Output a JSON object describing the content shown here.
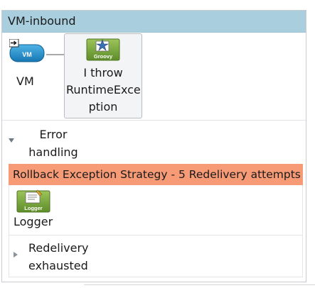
{
  "flow": {
    "title": "VM-inbound",
    "source": {
      "label": "VM",
      "icon": "vm-endpoint-icon",
      "icon_text": "VM"
    },
    "component": {
      "label": "I throw RuntimeException",
      "label_lines": [
        "I throw",
        "RuntimeExce",
        "ption"
      ],
      "icon": "groovy-icon",
      "icon_text": "Groovy"
    },
    "error_handling": {
      "label_lines": [
        "Error",
        "handling"
      ],
      "expanded": true,
      "strategy": {
        "title": "Rollback Exception Strategy - 5 Redelivery attempts",
        "processor": {
          "label": "Logger",
          "icon": "logger-icon",
          "icon_text": "Logger"
        },
        "redelivery": {
          "label_lines": [
            "Redelivery",
            "exhausted"
          ],
          "expanded": false
        }
      }
    }
  },
  "colors": {
    "header_bg": "#a9cfdf",
    "strategy_bg": "#f79a76",
    "icon_blue": "#1f8dc6",
    "icon_green": "#79a43a"
  }
}
